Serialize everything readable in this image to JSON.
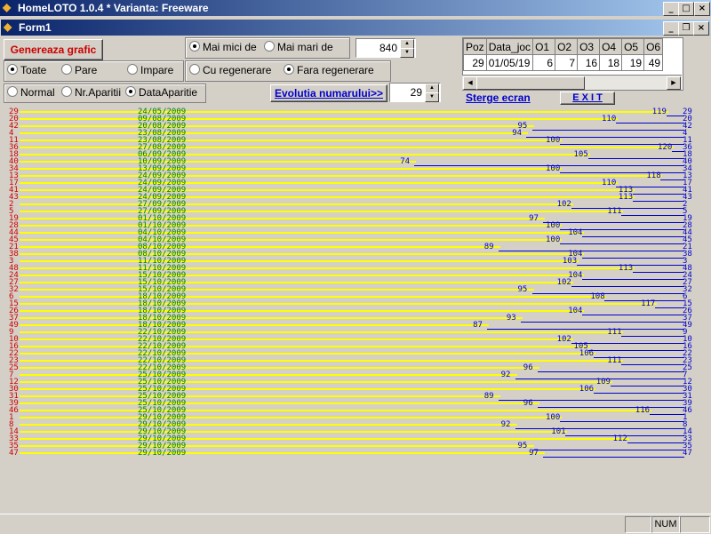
{
  "app": {
    "title": "HomeLOTO 1.0.4 * Varianta: Freeware"
  },
  "form": {
    "title": "Form1"
  },
  "controls": {
    "generate_label": "Genereaza grafic",
    "filter_options": [
      "Toate",
      "Pare",
      "Impare"
    ],
    "filter_selected": 0,
    "compare_options": [
      "Mai mici de",
      "Mai mari de"
    ],
    "compare_selected": 0,
    "compare_value": "840",
    "regen_options": [
      "Cu regenerare",
      "Fara regenerare"
    ],
    "regen_selected": 1,
    "sort_options": [
      "Normal",
      "Nr.Aparitii",
      "DataAparitie"
    ],
    "sort_selected": 2,
    "evolution_label": "Evolutia numarului>>",
    "evolution_value": "29",
    "clear_label": "Sterge ecran",
    "exit_label": "E X I T"
  },
  "grid": {
    "columns": [
      "Poz",
      "Data_joc",
      "O1",
      "O2",
      "O3",
      "O4",
      "O5",
      "O6"
    ],
    "rows": [
      [
        "29",
        "01/05/19",
        "6",
        "7",
        "16",
        "18",
        "19",
        "49"
      ]
    ]
  },
  "plot_rows": [
    {
      "num": "29",
      "date": "24/05/2009",
      "val": 119
    },
    {
      "num": "20",
      "date": "09/08/2009",
      "val": 110
    },
    {
      "num": "42",
      "date": "20/08/2009",
      "val": 95
    },
    {
      "num": "4",
      "date": "23/08/2009",
      "val": 94
    },
    {
      "num": "11",
      "date": "23/08/2009",
      "val": 100
    },
    {
      "num": "36",
      "date": "27/08/2009",
      "val": 120
    },
    {
      "num": "18",
      "date": "06/09/2009",
      "val": 105
    },
    {
      "num": "40",
      "date": "10/09/2009",
      "val": 74
    },
    {
      "num": "34",
      "date": "13/09/2009",
      "val": 100
    },
    {
      "num": "13",
      "date": "24/09/2009",
      "val": 118
    },
    {
      "num": "17",
      "date": "24/09/2009",
      "val": 110
    },
    {
      "num": "41",
      "date": "24/09/2009",
      "val": 113
    },
    {
      "num": "43",
      "date": "24/09/2009",
      "val": 113
    },
    {
      "num": "2",
      "date": "27/09/2009",
      "val": 102
    },
    {
      "num": "5",
      "date": "27/09/2009",
      "val": 111
    },
    {
      "num": "19",
      "date": "01/10/2009",
      "val": 97
    },
    {
      "num": "28",
      "date": "01/10/2009",
      "val": 100
    },
    {
      "num": "44",
      "date": "04/10/2009",
      "val": 104
    },
    {
      "num": "45",
      "date": "04/10/2009",
      "val": 100
    },
    {
      "num": "21",
      "date": "08/10/2009",
      "val": 89
    },
    {
      "num": "38",
      "date": "08/10/2009",
      "val": 104
    },
    {
      "num": "3",
      "date": "11/10/2009",
      "val": 103
    },
    {
      "num": "48",
      "date": "11/10/2009",
      "val": 113
    },
    {
      "num": "24",
      "date": "15/10/2009",
      "val": 104
    },
    {
      "num": "27",
      "date": "15/10/2009",
      "val": 102
    },
    {
      "num": "32",
      "date": "15/10/2009",
      "val": 95
    },
    {
      "num": "6",
      "date": "18/10/2009",
      "val": 108
    },
    {
      "num": "15",
      "date": "18/10/2009",
      "val": 117
    },
    {
      "num": "26",
      "date": "18/10/2009",
      "val": 104
    },
    {
      "num": "37",
      "date": "18/10/2009",
      "val": 93
    },
    {
      "num": "49",
      "date": "18/10/2009",
      "val": 87
    },
    {
      "num": "9",
      "date": "22/10/2009",
      "val": 111
    },
    {
      "num": "10",
      "date": "22/10/2009",
      "val": 102
    },
    {
      "num": "16",
      "date": "22/10/2009",
      "val": 105
    },
    {
      "num": "22",
      "date": "22/10/2009",
      "val": 106
    },
    {
      "num": "23",
      "date": "22/10/2009",
      "val": 111
    },
    {
      "num": "25",
      "date": "22/10/2009",
      "val": 96
    },
    {
      "num": "7",
      "date": "25/10/2009",
      "val": 92
    },
    {
      "num": "12",
      "date": "25/10/2009",
      "val": 109
    },
    {
      "num": "30",
      "date": "25/10/2009",
      "val": 106
    },
    {
      "num": "31",
      "date": "25/10/2009",
      "val": 89
    },
    {
      "num": "39",
      "date": "25/10/2009",
      "val": 96
    },
    {
      "num": "46",
      "date": "25/10/2009",
      "val": 116
    },
    {
      "num": "1",
      "date": "29/10/2009",
      "val": 100
    },
    {
      "num": "8",
      "date": "29/10/2009",
      "val": 92
    },
    {
      "num": "14",
      "date": "29/10/2009",
      "val": 101
    },
    {
      "num": "33",
      "date": "29/10/2009",
      "val": 112
    },
    {
      "num": "35",
      "date": "29/10/2009",
      "val": 95
    },
    {
      "num": "47",
      "date": "29/10/2009",
      "val": 97
    }
  ],
  "status": {
    "num": "NUM"
  },
  "colors": {
    "number": "#cc0000",
    "date": "#008000",
    "value": "#0000cc",
    "bar": "#ffff00"
  }
}
